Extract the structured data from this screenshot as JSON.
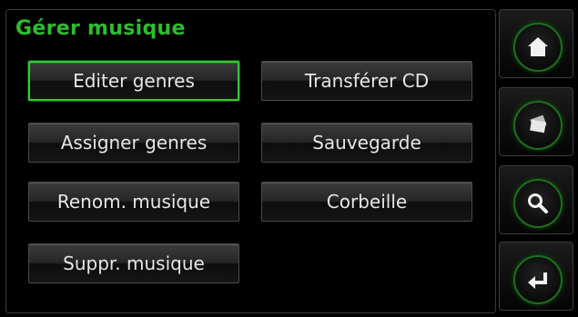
{
  "screen": {
    "title": "Gérer musique"
  },
  "buttons": {
    "edit_genres": "Editer genres",
    "transfer_cd": "Transférer CD",
    "assign_genres": "Assigner genres",
    "backup": "Sauvegarde",
    "rename_music": "Renom. musique",
    "trash": "Corbeille",
    "delete_music": "Suppr. musique"
  },
  "sidebar": {
    "items": [
      {
        "icon": "home-icon"
      },
      {
        "icon": "cards-icon"
      },
      {
        "icon": "search-icon"
      },
      {
        "icon": "back-icon"
      }
    ]
  },
  "colors": {
    "accent": "#2ebd2e",
    "text": "#e6e6e6",
    "background": "#000000"
  }
}
